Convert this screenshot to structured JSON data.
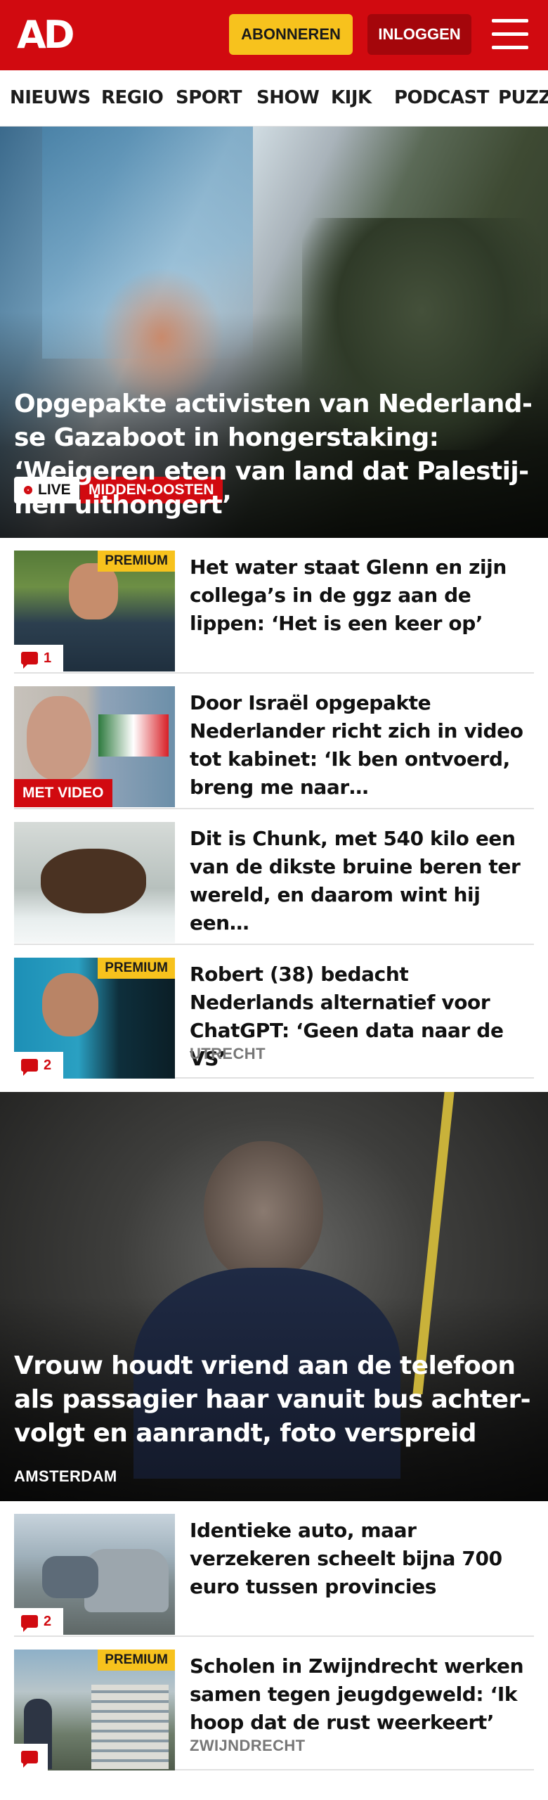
{
  "header": {
    "logo": "AD",
    "subscribe_label": "ABONNEREN",
    "login_label": "INLOGGEN",
    "menu_icon": "hamburger-menu-icon",
    "brand_color": "#d10a10",
    "accent_color": "#f7c21d"
  },
  "nav": {
    "items": [
      "NIEUWS",
      "REGIO",
      "SPORT",
      "SHOW",
      "KIJK",
      "PODCAST",
      "PUZZ"
    ]
  },
  "hero1": {
    "live_label": "LIVE",
    "category": "MIDDEN-OOSTEN",
    "title": "Opgepakte activisten van Nederland­se Gazaboot in hongerstaking: ‘Weigeren eten van land dat Palestij­nen uithongert’"
  },
  "articles": [
    {
      "title": "Het water staat Glenn en zijn collega’s in de ggz aan de lippen: ‘Het is een keer op’",
      "premium": "PREMIUM",
      "comments": "1"
    },
    {
      "title": "Door Israël opgepakte Nederlan­der richt zich in video tot kabinet: ‘Ik ben ontvoerd, breng me naar…",
      "video_label": "MET VIDEO"
    },
    {
      "title": "Dit is Chunk, met 540 kilo een van de dikste bruine beren ter wereld, en daarom wint hij een…"
    },
    {
      "title": "Robert (38) bedacht Nederlands alternatief voor ChatGPT: ‘Geen data naar de VS’",
      "premium": "PREMIUM",
      "comments": "2",
      "location": "UTRECHT"
    }
  ],
  "hero2": {
    "title": "Vrouw houdt vriend aan de telefoon als passagier haar vanuit bus achter­volgt en aanrandt, foto verspreid",
    "location": "AMSTERDAM"
  },
  "articles2": [
    {
      "title": "Identieke auto, maar verzekeren scheelt bijna 700 euro tussen provincies",
      "comments": "2"
    },
    {
      "title": "Scholen in Zwijndrecht werken samen tegen jeugdgeweld: ‘Ik hoop dat de rust weerkeert’",
      "premium": "PREMIUM",
      "location": "ZWIJNDRECHT"
    }
  ]
}
